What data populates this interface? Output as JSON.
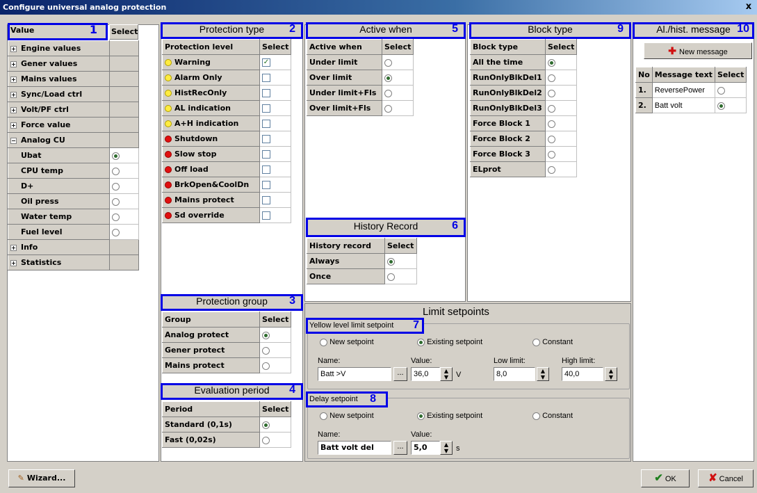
{
  "window": {
    "title": "Configure universal analog protection",
    "close": "x"
  },
  "sections": {
    "value": {
      "title": "Value",
      "num": "1",
      "select": "Select"
    },
    "protection_type": {
      "title": "Protection type",
      "num": "2"
    },
    "protection_group": {
      "title": "Protection group",
      "num": "3"
    },
    "evaluation_period": {
      "title": "Evaluation period",
      "num": "4"
    },
    "active_when": {
      "title": "Active when",
      "num": "5"
    },
    "history_record": {
      "title": "History Record",
      "num": "6"
    },
    "yellow_level": {
      "title": "Yellow level limit setpoint",
      "num": "7"
    },
    "delay": {
      "title": "Delay setpoint",
      "num": "8"
    },
    "block_type": {
      "title": "Block type",
      "num": "9"
    },
    "messages": {
      "title": "Al./hist. message",
      "num": "10"
    }
  },
  "value_tree": [
    {
      "label": "Engine values",
      "exp": "+"
    },
    {
      "label": "Gener values",
      "exp": "+"
    },
    {
      "label": "Mains values",
      "exp": "+"
    },
    {
      "label": "Sync/Load ctrl",
      "exp": "+"
    },
    {
      "label": "Volt/PF ctrl",
      "exp": "+"
    },
    {
      "label": "Force value",
      "exp": "+"
    },
    {
      "label": "Analog CU",
      "exp": "−"
    },
    {
      "label": "Ubat",
      "child": true,
      "radio": "on"
    },
    {
      "label": "CPU temp",
      "child": true,
      "radio": "off"
    },
    {
      "label": "D+",
      "child": true,
      "radio": "off"
    },
    {
      "label": "Oil press",
      "child": true,
      "radio": "off"
    },
    {
      "label": "Water temp",
      "child": true,
      "radio": "off"
    },
    {
      "label": "Fuel level",
      "child": true,
      "radio": "off"
    },
    {
      "label": "Info",
      "exp": "+"
    },
    {
      "label": "Statistics",
      "exp": "+"
    }
  ],
  "protection": {
    "headers": [
      "Protection level",
      "Select"
    ],
    "rows": [
      {
        "label": "Warning",
        "color": "y",
        "checked": true
      },
      {
        "label": "Alarm Only",
        "color": "y",
        "checked": false
      },
      {
        "label": "HistRecOnly",
        "color": "y",
        "checked": false
      },
      {
        "label": "AL indication",
        "color": "y",
        "checked": false
      },
      {
        "label": "A+H indication",
        "color": "y",
        "checked": false
      },
      {
        "label": "Shutdown",
        "color": "r",
        "checked": false
      },
      {
        "label": "Slow stop",
        "color": "r",
        "checked": false
      },
      {
        "label": "Off load",
        "color": "r",
        "checked": false
      },
      {
        "label": "BrkOpen&CoolDn",
        "color": "r",
        "checked": false
      },
      {
        "label": "Mains protect",
        "color": "r",
        "checked": false
      },
      {
        "label": "Sd override",
        "color": "r",
        "checked": false
      }
    ]
  },
  "group": {
    "headers": [
      "Group",
      "Select"
    ],
    "rows": [
      {
        "label": "Analog protect",
        "on": true
      },
      {
        "label": "Gener protect",
        "on": false
      },
      {
        "label": "Mains protect",
        "on": false
      }
    ]
  },
  "period": {
    "headers": [
      "Period",
      "Select"
    ],
    "rows": [
      {
        "label": "Standard (0,1s)",
        "on": true
      },
      {
        "label": "Fast (0,02s)",
        "on": false
      }
    ]
  },
  "active": {
    "headers": [
      "Active when",
      "Select"
    ],
    "rows": [
      {
        "label": "Under limit",
        "on": false
      },
      {
        "label": "Over limit",
        "on": true
      },
      {
        "label": "Under limit+Fls",
        "on": false
      },
      {
        "label": "Over limit+Fls",
        "on": false
      }
    ]
  },
  "history": {
    "headers": [
      "History record",
      "Select"
    ],
    "rows": [
      {
        "label": "Always",
        "on": true
      },
      {
        "label": "Once",
        "on": false
      }
    ]
  },
  "block": {
    "headers": [
      "Block type",
      "Select"
    ],
    "rows": [
      {
        "label": "All the time",
        "on": true
      },
      {
        "label": "RunOnlyBlkDel1",
        "on": false
      },
      {
        "label": "RunOnlyBlkDel2",
        "on": false
      },
      {
        "label": "RunOnlyBlkDel3",
        "on": false
      },
      {
        "label": "Force Block 1",
        "on": false
      },
      {
        "label": "Force Block 2",
        "on": false
      },
      {
        "label": "Force Block 3",
        "on": false
      },
      {
        "label": "ELprot",
        "on": false
      }
    ]
  },
  "messages": {
    "new_button": "New message",
    "headers": [
      "No",
      "Message text",
      "Select"
    ],
    "rows": [
      {
        "no": "1.",
        "text": "ReversePower",
        "on": false
      },
      {
        "no": "2.",
        "text": "Batt volt",
        "on": true
      }
    ]
  },
  "limit": {
    "title": "Limit setpoints",
    "yellow": {
      "opt_new": "New setpoint",
      "opt_existing": "Existing setpoint",
      "opt_constant": "Constant",
      "selected": "existing",
      "name_label": "Name:",
      "name_value": "Batt >V",
      "browse": "...",
      "value_label": "Value:",
      "value": "36,0",
      "unit": "V",
      "low_label": "Low limit:",
      "low_value": "8,0",
      "high_label": "High limit:",
      "high_value": "40,0"
    },
    "delay": {
      "opt_new": "New setpoint",
      "opt_existing": "Existing setpoint",
      "opt_constant": "Constant",
      "selected": "existing",
      "name_label": "Name:",
      "name_value": "Batt volt del",
      "browse": "...",
      "value_label": "Value:",
      "value": "5,0",
      "unit": "s"
    }
  },
  "footer": {
    "wizard": "Wizard...",
    "ok": "OK",
    "cancel": "Cancel"
  }
}
